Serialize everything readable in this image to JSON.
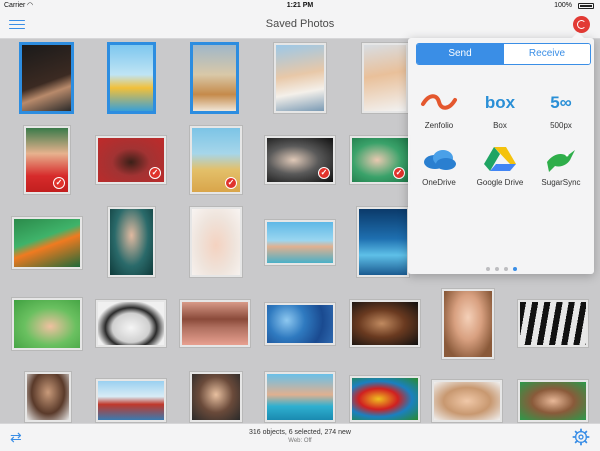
{
  "status_bar": {
    "carrier": "Carrier",
    "time": "1:21 PM",
    "battery": "100%"
  },
  "navbar": {
    "title": "Saved Photos",
    "menu_icon": "hamburger-icon",
    "record_icon": "record-icon"
  },
  "popover": {
    "tabs": [
      {
        "label": "Send",
        "active": true
      },
      {
        "label": "Receive",
        "active": false
      }
    ],
    "services": [
      {
        "label": "Zenfolio",
        "icon": "zenfolio-icon"
      },
      {
        "label": "Box",
        "icon": "box-icon"
      },
      {
        "label": "500px",
        "icon": "500px-icon"
      },
      {
        "label": "OneDrive",
        "icon": "onedrive-icon"
      },
      {
        "label": "Google Drive",
        "icon": "google-drive-icon"
      },
      {
        "label": "SugarSync",
        "icon": "sugarsync-icon"
      }
    ],
    "page_dots": 4,
    "active_dot": 4
  },
  "bottom_bar": {
    "summary": "316 objects, 6 selected, 274 new",
    "web_status": "Web: Off",
    "sync_icon": "sync-arrows-icon",
    "settings_icon": "gear-icon"
  },
  "photos_meta": {
    "total": 316,
    "selected": 6,
    "new": 274
  },
  "colors": {
    "accent": "#3a8ee6",
    "selection_badge": "#e0332c",
    "background": "#c9c9cb"
  }
}
